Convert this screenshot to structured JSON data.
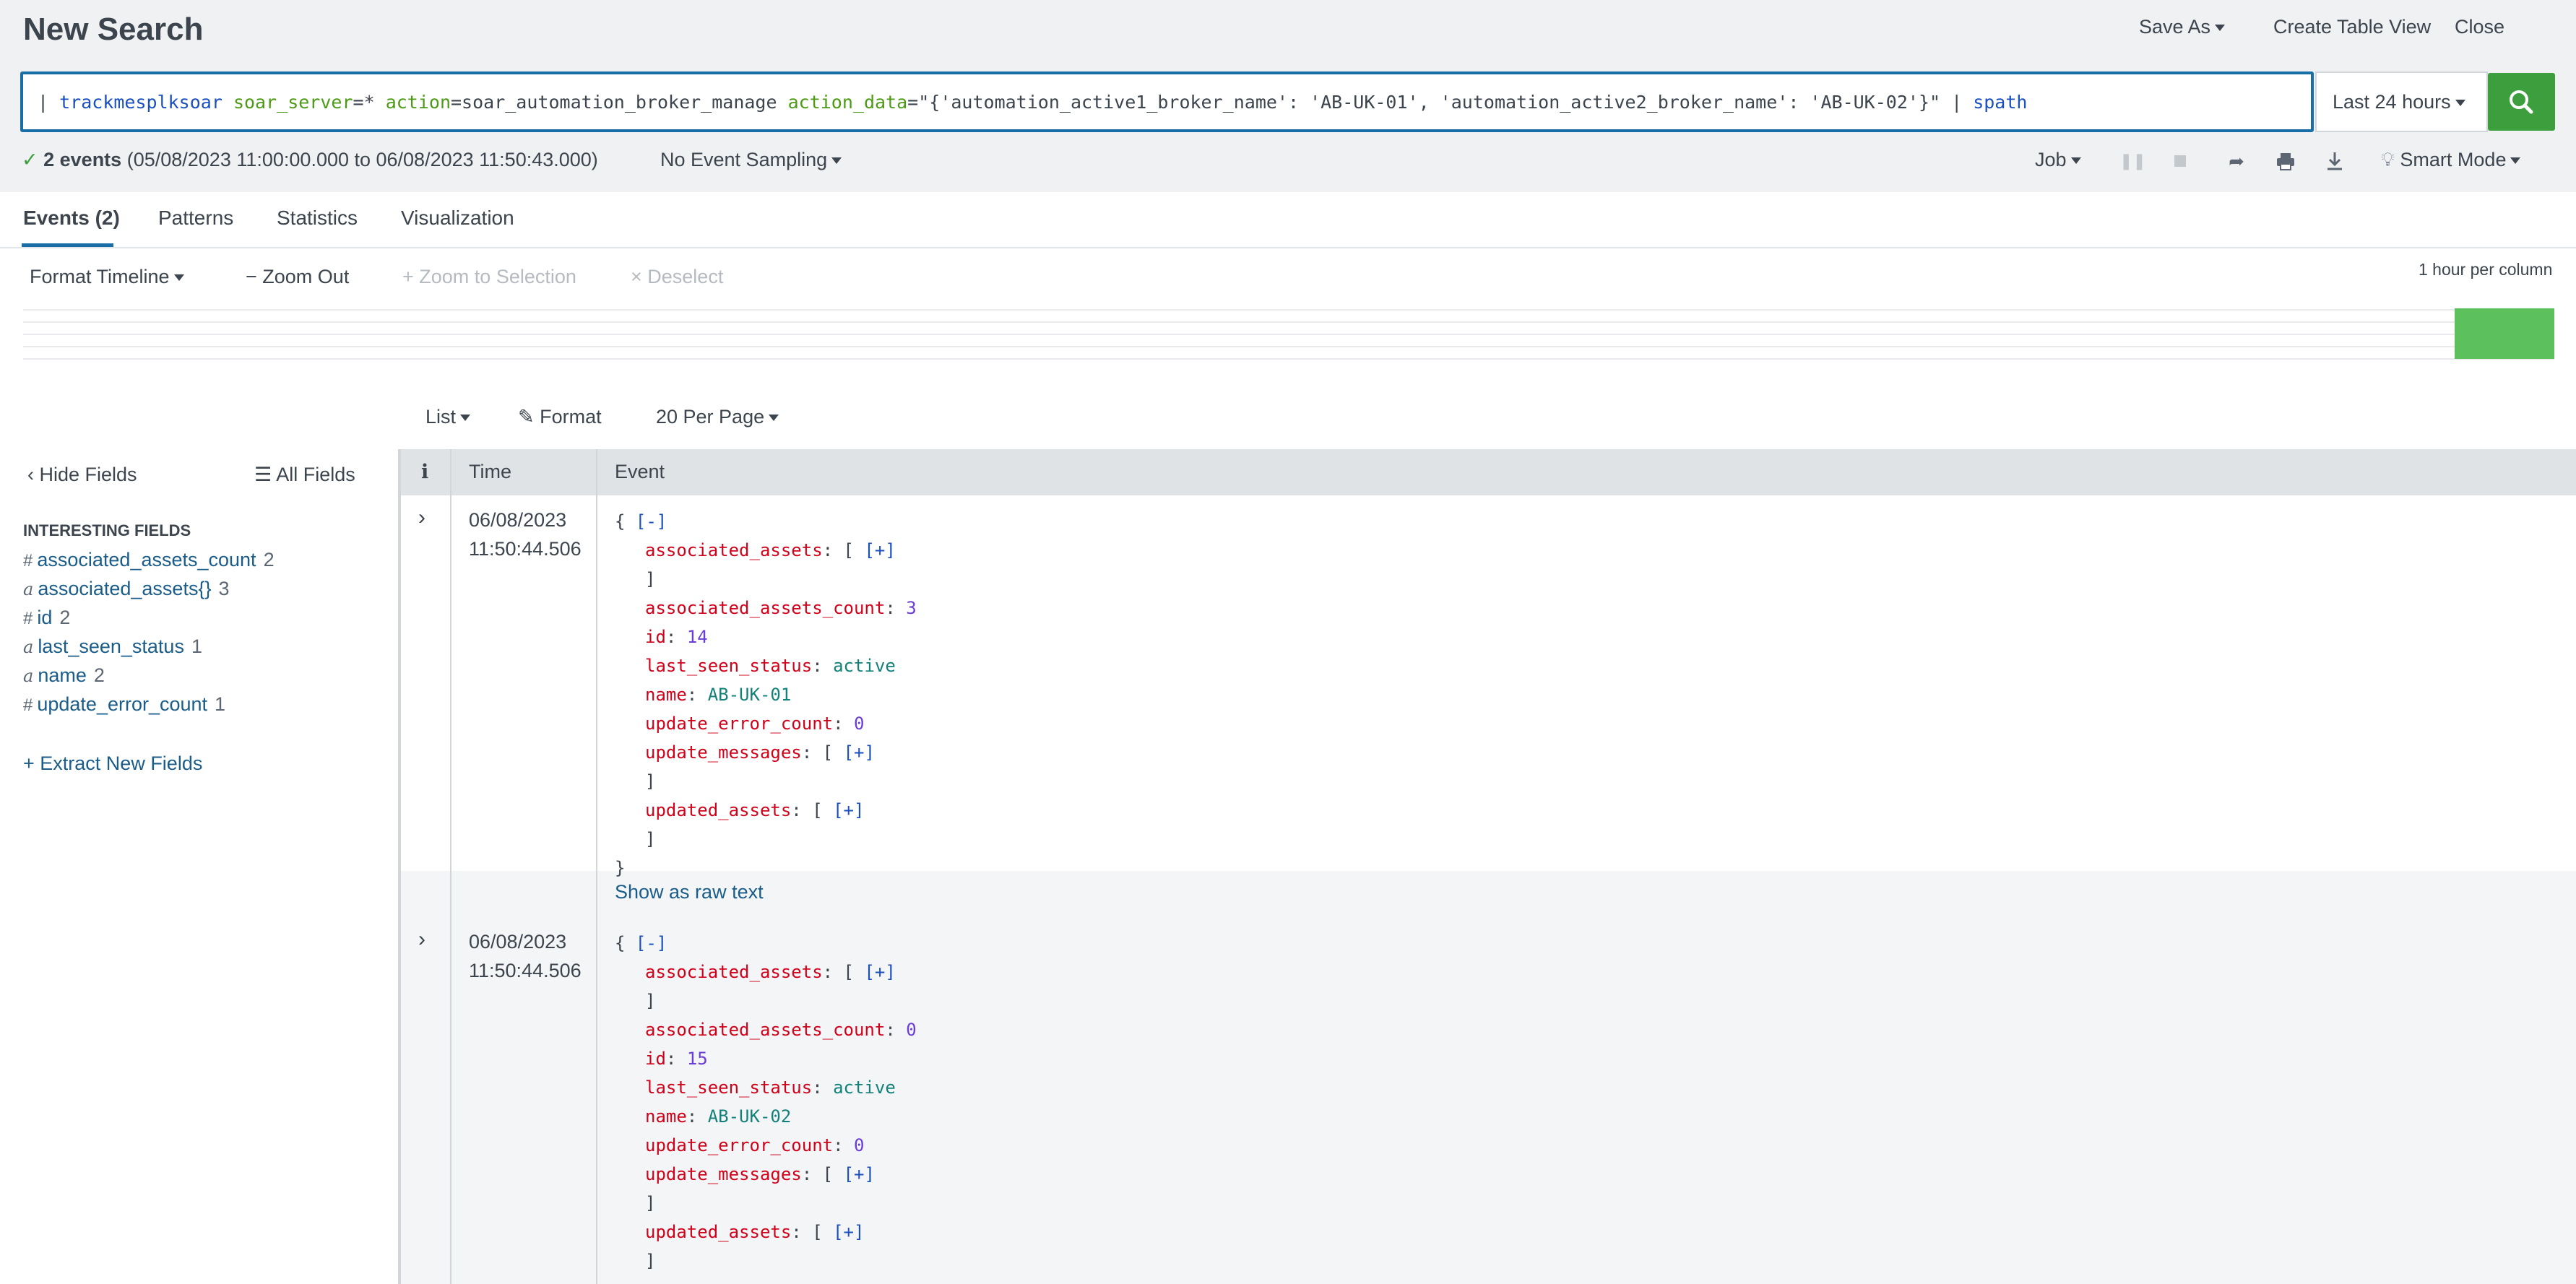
{
  "header": {
    "title": "New Search",
    "save_as": "Save As",
    "create_table_view": "Create Table View",
    "close": "Close"
  },
  "search": {
    "pipe": "| ",
    "command": "trackmesplksoar",
    "field1": "soar_server",
    "eq1": "=* ",
    "field2": "action",
    "eq2": "=soar_automation_broker_manage ",
    "field3": "action_data",
    "eq3": "=\"{'automation_active1_broker_name': 'AB-UK-01', 'automation_active2_broker_name': 'AB-UK-02'}\" | ",
    "command2": "spath",
    "time_range": "Last 24 hours"
  },
  "status": {
    "count": "2 events",
    "range": "(05/08/2023 11:00:00.000 to 06/08/2023 11:50:43.000)",
    "sampling": "No Event Sampling",
    "job": "Job",
    "mode": "Smart Mode"
  },
  "tabs": [
    "Events (2)",
    "Patterns",
    "Statistics",
    "Visualization"
  ],
  "timeline": {
    "format": "Format Timeline",
    "zoom_out": "Zoom Out",
    "zoom_selection": "Zoom to Selection",
    "deselect": "Deselect",
    "scale": "1 hour per column"
  },
  "results_toolbar": {
    "list": "List",
    "format": "Format",
    "per_page": "20 Per Page"
  },
  "fields_panel": {
    "hide": "Hide Fields",
    "all": "All Fields",
    "heading": "INTERESTING FIELDS",
    "fields": [
      {
        "type": "#",
        "name": "associated_assets_count",
        "count": "2"
      },
      {
        "type": "a",
        "name": "associated_assets{}",
        "count": "3"
      },
      {
        "type": "#",
        "name": "id",
        "count": "2"
      },
      {
        "type": "a",
        "name": "last_seen_status",
        "count": "1"
      },
      {
        "type": "a",
        "name": "name",
        "count": "2"
      },
      {
        "type": "#",
        "name": "update_error_count",
        "count": "1"
      }
    ],
    "extract": "Extract New Fields"
  },
  "table": {
    "col_info": "i",
    "col_time": "Time",
    "col_event": "Event",
    "open_brace": "{",
    "close_brace": "}",
    "collapse": "[-]",
    "expand": "[+]",
    "open_bracket": "[",
    "close_bracket": "]",
    "raw_text": "Show as raw text",
    "keys": {
      "associated_assets": "associated_assets",
      "associated_assets_count": "associated_assets_count",
      "id": "id",
      "last_seen_status": "last_seen_status",
      "name": "name",
      "update_error_count": "update_error_count",
      "update_messages": "update_messages",
      "updated_assets": "updated_assets"
    },
    "events": [
      {
        "date": "06/08/2023",
        "time": "11:50:44.506",
        "associated_assets_count": "3",
        "id": "14",
        "last_seen_status": "active",
        "name": "AB-UK-01",
        "update_error_count": "0"
      },
      {
        "date": "06/08/2023",
        "time": "11:50:44.506",
        "associated_assets_count": "0",
        "id": "15",
        "last_seen_status": "active",
        "name": "AB-UK-02",
        "update_error_count": "0"
      }
    ]
  },
  "colors": {
    "accent": "#1a6ea8",
    "search_button": "#3c9e3c",
    "timeline_bar": "#5cc05c",
    "json_key": "#d0021b"
  }
}
